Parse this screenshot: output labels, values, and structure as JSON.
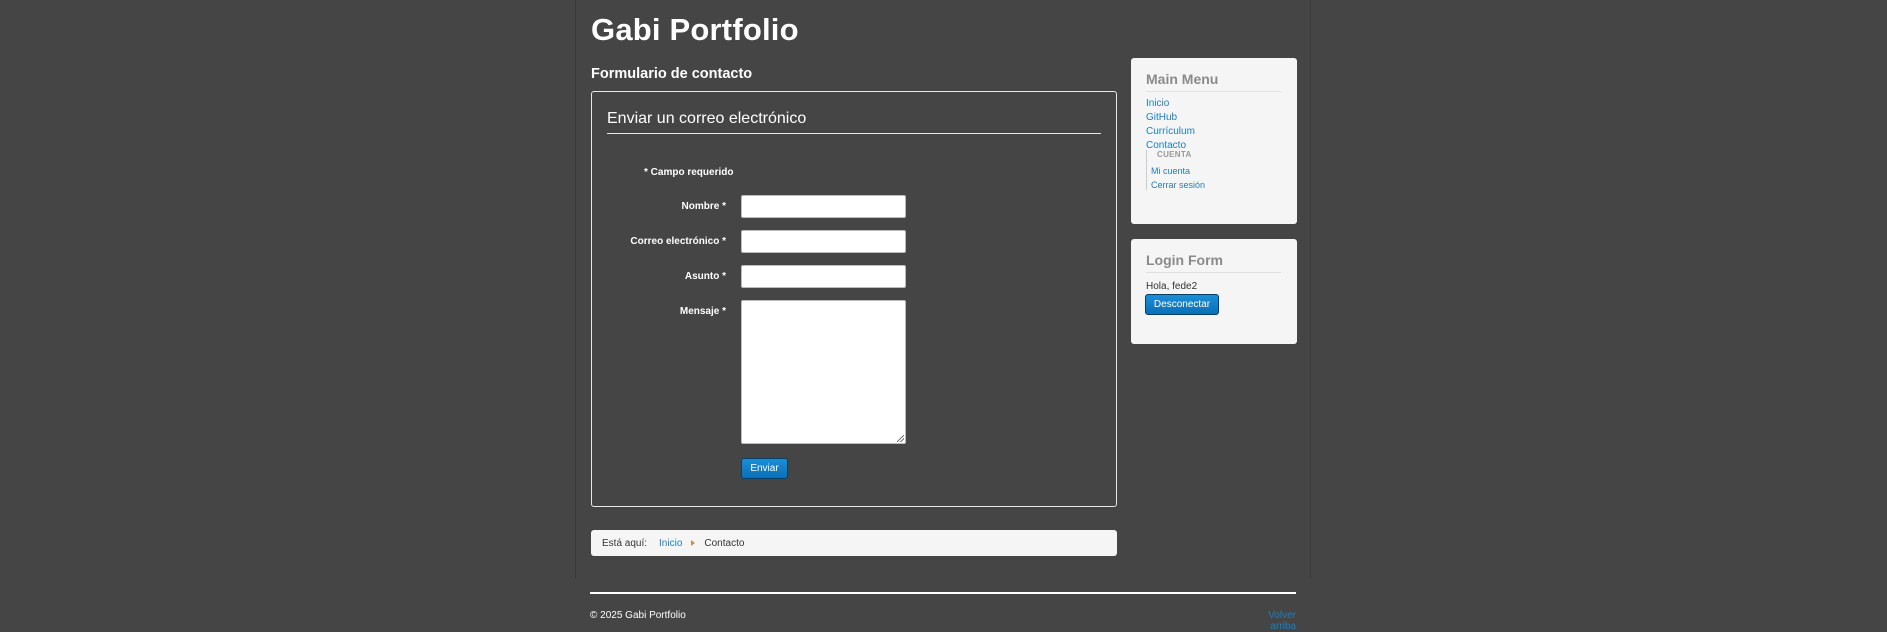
{
  "header": {
    "site_title": "Gabi Portfolio"
  },
  "main": {
    "page_heading": "Formulario de contacto",
    "form": {
      "legend": "Enviar un correo electrónico",
      "required_note": "* Campo requerido",
      "fields": [
        {
          "label": "Nombre *",
          "value": "",
          "placeholder": ""
        },
        {
          "label": "Correo electrónico *",
          "value": "",
          "placeholder": ""
        },
        {
          "label": "Asunto *",
          "value": "",
          "placeholder": ""
        },
        {
          "label": "Mensaje *",
          "value": "",
          "placeholder": ""
        }
      ],
      "submit_label": "Enviar"
    },
    "breadcrumb": {
      "prefix": "Está aquí:",
      "items": [
        "Inicio",
        "Contacto"
      ]
    }
  },
  "sidebar": {
    "main_menu": {
      "title": "Main Menu",
      "items": [
        "Inicio",
        "GitHub",
        "Currículum",
        "Contacto"
      ],
      "submenu": {
        "header": "CUENTA",
        "items": [
          "Mi cuenta",
          "Cerrar sesión"
        ]
      }
    },
    "login_form": {
      "title": "Login Form",
      "greeting": "Hola, fede2",
      "logout_label": "Desconectar"
    }
  },
  "footer": {
    "copyright": "© 2025 Gabi Portfolio",
    "back_to_top": "Volver arriba"
  },
  "colors": {
    "background": "#454545",
    "link": "#1a7fc1",
    "button": "#0a6fb8",
    "module_bg": "#f5f5f5"
  }
}
